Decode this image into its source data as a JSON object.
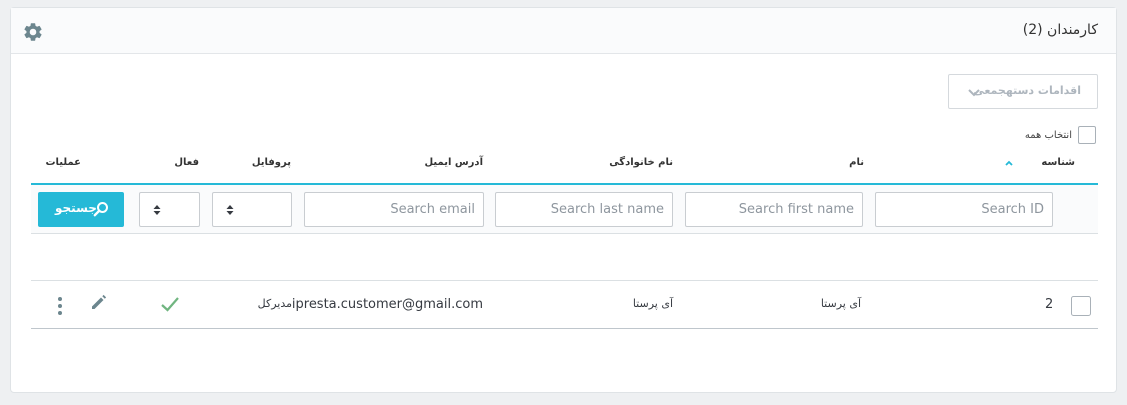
{
  "header": {
    "title": "کارمندان (2)"
  },
  "bulk_actions": {
    "label": "اقدامات دستهجمعی"
  },
  "select_all": {
    "label": "انتخاب همه"
  },
  "table": {
    "columns": {
      "id": "شناسه",
      "first_name": "نام",
      "last_name": "نام خانوادگی",
      "email": "آدرس ایمیل",
      "profile": "پروفایل",
      "active": "فعال",
      "actions": "عملیات"
    },
    "filters": {
      "id_placeholder": "Search ID",
      "first_name_placeholder": "Search first name",
      "last_name_placeholder": "Search last name",
      "email_placeholder": "Search email",
      "search_button": "جستجو"
    },
    "rows": [
      {
        "id": "2",
        "first_name": "آی پرستا",
        "last_name": "آی پرستا",
        "email": "ipresta.customer@gmail.com",
        "profile": "مدیرکل",
        "active": true
      }
    ]
  },
  "colors": {
    "accent": "#25b9d7",
    "active_check": "#70b580",
    "icon_gray": "#6c868e"
  },
  "icons": {
    "settings": "gear-icon",
    "bulk_dropdown": "chevron-down-icon",
    "sort": "sort-up-icon",
    "search": "magnifier-icon",
    "select": "sort-arrows-icon",
    "active": "check-icon",
    "edit": "pencil-icon",
    "more": "vertical-dots-icon"
  }
}
